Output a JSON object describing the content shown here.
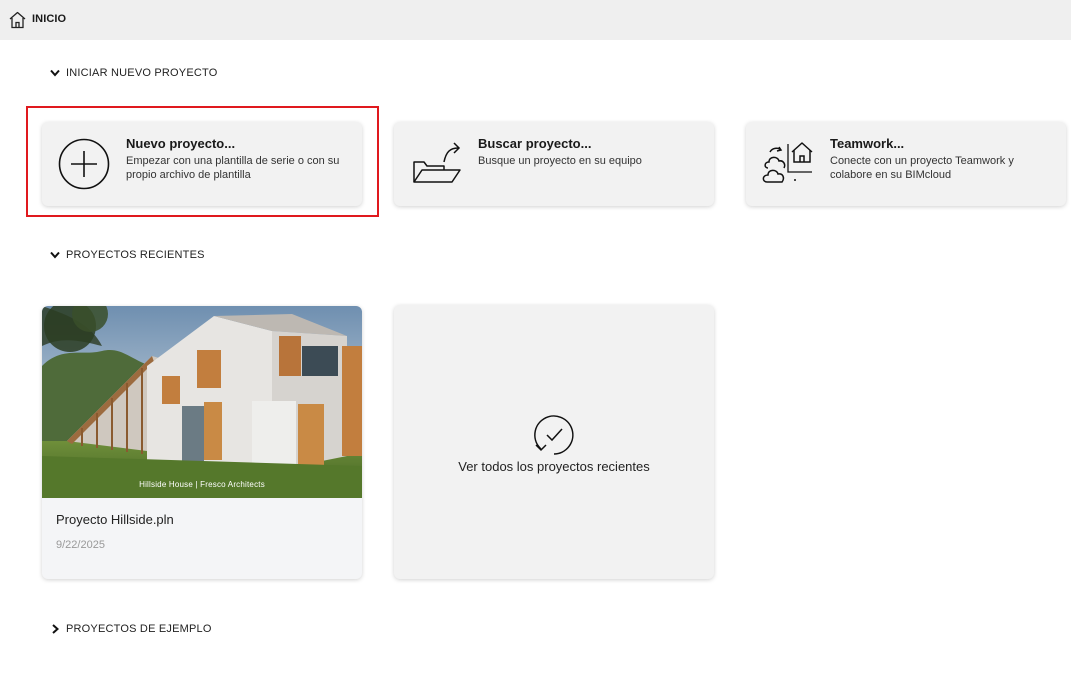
{
  "topbar": {
    "title": "INICIO",
    "icon": "home-icon"
  },
  "sections": {
    "start": {
      "label": "INICIAR NUEVO PROYECTO",
      "expanded": true
    },
    "recent": {
      "label": "PROYECTOS RECIENTES",
      "expanded": true
    },
    "examples": {
      "label": "PROYECTOS DE EJEMPLO",
      "expanded": false
    }
  },
  "actions": [
    {
      "title": "Nuevo proyecto...",
      "desc": "Empezar con una plantilla de serie o con su propio archivo de plantilla",
      "icon": "plus-circle-icon"
    },
    {
      "title": "Buscar proyecto...",
      "desc": "Busque un proyecto en su equipo",
      "icon": "open-folder-icon"
    },
    {
      "title": "Teamwork...",
      "desc": "Conecte con un proyecto Teamwork y colabore en su BIMcloud",
      "icon": "teamwork-cloud-icon"
    }
  ],
  "recent_projects": [
    {
      "name": "Proyecto Hillside.pln",
      "date": "9/22/2025",
      "thumbnail_caption": "Hillside House | Fresco Architects"
    }
  ],
  "view_all": {
    "label": "Ver todos los proyectos recientes",
    "icon": "recent-check-icon"
  },
  "colors": {
    "topbar_bg": "#efefef",
    "card_bg": "#f2f2f2",
    "highlight": "#e0191e"
  }
}
